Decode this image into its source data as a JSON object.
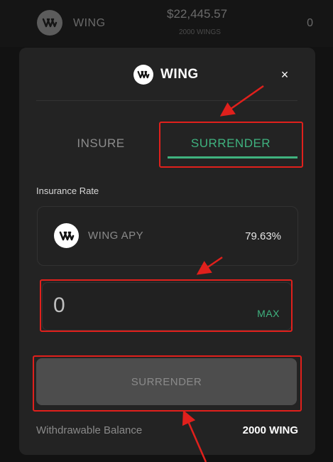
{
  "background_row": {
    "name": "WING",
    "amount": "$22,445.57",
    "sub": "2000 WINGS",
    "count": "0",
    "logo_icon": "wing-logo-icon"
  },
  "modal": {
    "title": "WING",
    "logo_icon": "wing-logo-icon",
    "close_label": "×",
    "tabs": [
      {
        "label": "INSURE",
        "active": false
      },
      {
        "label": "SURRENDER",
        "active": true
      }
    ],
    "rate_label": "Insurance Rate",
    "rate": {
      "name": "WING APY",
      "value": "79.63%",
      "logo_icon": "wing-logo-icon"
    },
    "amount_input": {
      "value": "0",
      "max_label": "MAX"
    },
    "action_label": "SURRENDER",
    "balance": {
      "label": "Withdrawable Balance",
      "value": "2000 WING"
    }
  },
  "colors": {
    "page_bg": "#121212",
    "modal_bg": "#232323",
    "accent_green": "#3fb27f",
    "annotation_red": "#e0201c",
    "button_bg": "#4d4d4d"
  }
}
